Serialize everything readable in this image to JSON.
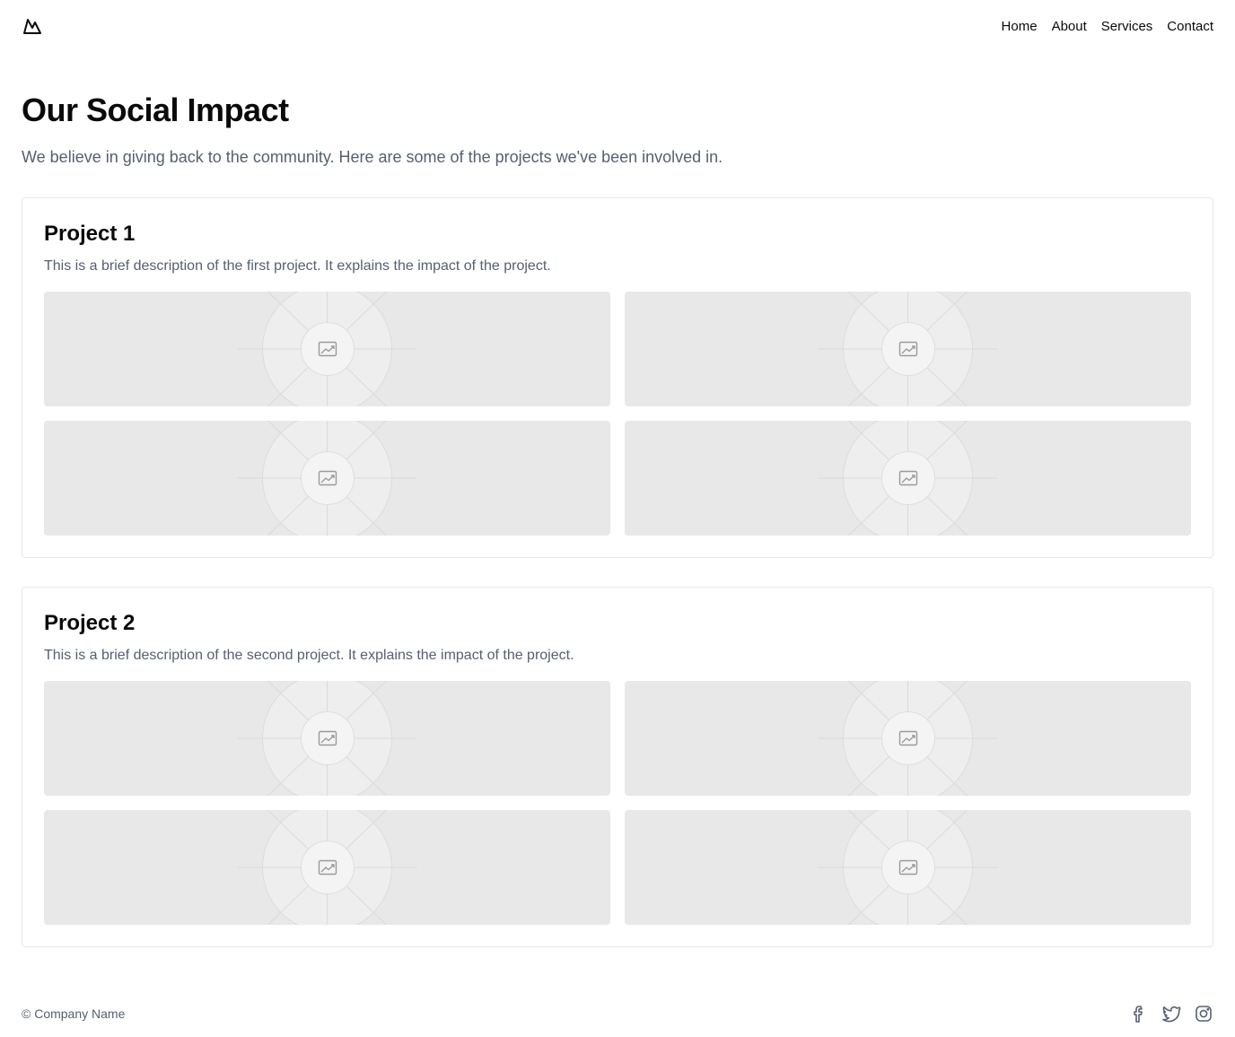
{
  "header": {
    "logo_icon": "mountain-logo-icon",
    "nav": [
      {
        "label": "Home"
      },
      {
        "label": "About"
      },
      {
        "label": "Services"
      },
      {
        "label": "Contact"
      }
    ]
  },
  "hero": {
    "title": "Our Social Impact",
    "subtitle": "We believe in giving back to the community. Here are some of the projects we've been involved in."
  },
  "projects": [
    {
      "title": "Project 1",
      "description": "This is a brief description of the first project. It explains the impact of the project.",
      "images": [
        "image-placeholder-icon",
        "image-placeholder-icon",
        "image-placeholder-icon",
        "image-placeholder-icon"
      ]
    },
    {
      "title": "Project 2",
      "description": "This is a brief description of the second project. It explains the impact of the project.",
      "images": [
        "image-placeholder-icon",
        "image-placeholder-icon",
        "image-placeholder-icon",
        "image-placeholder-icon"
      ]
    }
  ],
  "footer": {
    "copyright": "© Company Name",
    "social_icons": [
      "facebook-icon",
      "twitter-icon",
      "instagram-icon"
    ]
  },
  "colors": {
    "text": "#0a0a0a",
    "muted": "#556070",
    "border": "#e5e7eb",
    "placeholder_bg": "#e8e8e8"
  }
}
